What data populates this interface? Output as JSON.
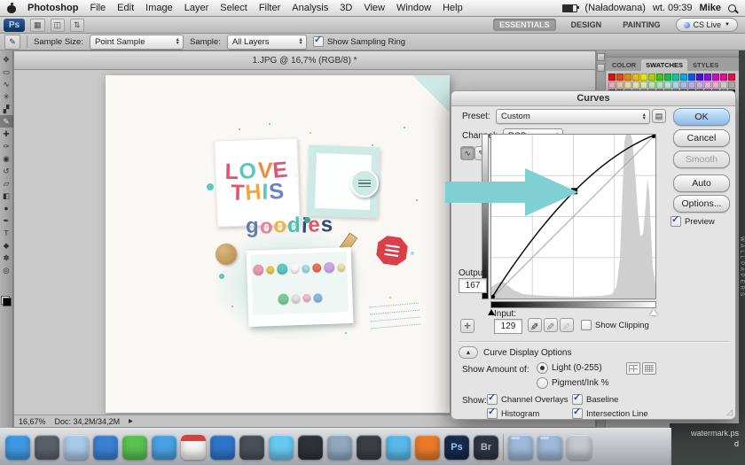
{
  "desktop": {
    "wallpaper_text": "WALLPAPERS",
    "watermark_line1": "watermark.ps",
    "watermark_line2": "d"
  },
  "menu_bar": {
    "app": "Photoshop",
    "items": [
      "File",
      "Edit",
      "Image",
      "Layer",
      "Select",
      "Filter",
      "Analysis",
      "3D",
      "View",
      "Window",
      "Help"
    ],
    "battery_text": "(Naładowana)",
    "clock": "wt. 09:39",
    "user": "Mike"
  },
  "app_bar": {
    "logo": "Ps",
    "workspaces": [
      {
        "label": "ESSENTIALS",
        "active": true
      },
      {
        "label": "DESIGN",
        "active": false
      },
      {
        "label": "PAINTING",
        "active": false
      }
    ],
    "cs_live": "CS Live"
  },
  "options_bar": {
    "sample_size_label": "Sample Size:",
    "sample_size_value": "Point Sample",
    "sample_label": "Sample:",
    "sample_value": "All Layers",
    "sampling_ring_label": "Show Sampling Ring",
    "sampling_ring_checked": true
  },
  "tools": [
    {
      "name": "move",
      "glyph": "✥"
    },
    {
      "name": "marquee",
      "glyph": "▭"
    },
    {
      "name": "lasso",
      "glyph": "∿"
    },
    {
      "name": "quick-selection",
      "glyph": "✳"
    },
    {
      "name": "crop",
      "glyph": "▞"
    },
    {
      "name": "eyedropper",
      "glyph": "✎",
      "selected": true
    },
    {
      "name": "healing-brush",
      "glyph": "✚"
    },
    {
      "name": "brush",
      "glyph": "✑"
    },
    {
      "name": "clone-stamp",
      "glyph": "◉"
    },
    {
      "name": "history-brush",
      "glyph": "↺"
    },
    {
      "name": "eraser",
      "glyph": "▱"
    },
    {
      "name": "gradient",
      "glyph": "◧"
    },
    {
      "name": "blur",
      "glyph": "●"
    },
    {
      "name": "pen",
      "glyph": "✒"
    },
    {
      "name": "type",
      "glyph": "T"
    },
    {
      "name": "shape",
      "glyph": "◆"
    },
    {
      "name": "hand",
      "glyph": "✽"
    },
    {
      "name": "zoom",
      "glyph": "◎"
    }
  ],
  "document": {
    "title": "1.JPG @ 16,7% (RGB/8) *",
    "status_zoom": "16,67%",
    "status_doc": "Doc: 34,2M/34,2M"
  },
  "artwork": {
    "love_letters": [
      {
        "ch": "L",
        "color": "#e0566e"
      },
      {
        "ch": "O",
        "color": "#5cc6bf"
      },
      {
        "ch": "V",
        "color": "#ee8a3c"
      },
      {
        "ch": "E",
        "color": "#e0566e"
      }
    ],
    "this_letters": [
      {
        "ch": "T",
        "color": "#e0566e"
      },
      {
        "ch": "H",
        "color": "#f0a83c"
      },
      {
        "ch": "I",
        "color": "#5cc6bf"
      },
      {
        "ch": "S",
        "color": "#6b82c4"
      }
    ],
    "goodies_letters": [
      {
        "ch": "g",
        "color": "#5b7fb5"
      },
      {
        "ch": "o",
        "color": "#e87ea1"
      },
      {
        "ch": "o",
        "color": "#f0b43c"
      },
      {
        "ch": "d",
        "color": "#52bdb6"
      },
      {
        "ch": "i",
        "color": "#2e4a7a"
      },
      {
        "ch": "e",
        "color": "#d8566a"
      },
      {
        "ch": "s",
        "color": "#2e4a7a"
      }
    ],
    "button_colors": [
      "#e89ab0",
      "#f0c452",
      "#5cc6bf",
      "#f8f8f8",
      "#a8d8e8",
      "#e8705a",
      "#c8a8e0",
      "#f0e0a0",
      "#7ac8a0",
      "#e0e0e0",
      "#f2b8c8",
      "#88b8e0"
    ]
  },
  "panels": {
    "tabs": [
      {
        "label": "COLOR",
        "active": false
      },
      {
        "label": "SWATCHES",
        "active": true
      },
      {
        "label": "STYLES",
        "active": false
      }
    ],
    "swatches": [
      "#e81010",
      "#e84b10",
      "#e88a10",
      "#e8c010",
      "#e8e810",
      "#a8d810",
      "#48c810",
      "#10c848",
      "#10c8a8",
      "#10a8e8",
      "#1058e8",
      "#4810e8",
      "#8a10e8",
      "#c810c8",
      "#e8108a",
      "#e81048",
      "#f5b8b8",
      "#f5cdb8",
      "#f5e2b8",
      "#f5f0b8",
      "#e8f5b8",
      "#c8f5b8",
      "#b8f5c8",
      "#b8f5e8",
      "#b8e2f5",
      "#b8c8f5",
      "#c4b8f5",
      "#dcb8f5",
      "#f5b8ec",
      "#f5b8d2",
      "#d8d8d8",
      "#b0b0b0",
      "#8a0b0b",
      "#8a3c0b",
      "#8a5c0b",
      "#8a7c0b",
      "#6c8a0b",
      "#3c8a0b",
      "#0b8a2c",
      "#0b8a6c",
      "#0b6c8a",
      "#0b3c8a",
      "#1c0b8a",
      "#4c0b8a",
      "#7c0b8a",
      "#8a0b5c",
      "#5a5a5a",
      "#2a2a2a"
    ]
  },
  "curves": {
    "title": "Curves",
    "preset_label": "Preset:",
    "preset_value": "Custom",
    "channel_label": "Channel:",
    "channel_value": "RGB",
    "ok": "OK",
    "cancel": "Cancel",
    "smooth": "Smooth",
    "auto": "Auto",
    "options": "Options...",
    "preview_label": "Preview",
    "preview_checked": true,
    "output_label": "Output:",
    "output_value": "167",
    "input_label": "Input:",
    "input_value": "129",
    "show_clipping_label": "Show Clipping",
    "show_clipping_checked": false,
    "display_options_label": "Curve Display Options",
    "show_amount_label": "Show Amount of:",
    "amount_options": [
      {
        "label": "Light (0-255)",
        "selected": true
      },
      {
        "label": "Pigment/Ink %",
        "selected": false
      }
    ],
    "show_label": "Show:",
    "show_checkboxes": [
      {
        "label": "Channel Overlays",
        "checked": true
      },
      {
        "label": "Baseline",
        "checked": true
      },
      {
        "label": "Histogram",
        "checked": true
      },
      {
        "label": "Intersection Line",
        "checked": true
      }
    ],
    "curve_point": {
      "input": 129,
      "output": 167
    },
    "accent_arrow_color": "#7ed0d3"
  },
  "dock": {
    "apps": [
      {
        "name": "finder",
        "color": "#3f97e0"
      },
      {
        "name": "dashboard",
        "color": "#5a6069"
      },
      {
        "name": "mail",
        "color": "#a9c9e9"
      },
      {
        "name": "safari",
        "color": "#3b7fd0"
      },
      {
        "name": "ichat",
        "color": "#58c050"
      },
      {
        "name": "itunes",
        "color": "#4aa0e0"
      },
      {
        "name": "ical",
        "color": "#f4f4f0",
        "cal": true
      },
      {
        "name": "app-store",
        "color": "#2f74c8"
      },
      {
        "name": "photo-booth",
        "color": "#4a4f58"
      },
      {
        "name": "twitter",
        "color": "#68c8f0"
      },
      {
        "name": "terminal",
        "color": "#2e3238"
      },
      {
        "name": "preview",
        "color": "#8fa8bf"
      },
      {
        "name": "dvd-player",
        "color": "#3a3f46"
      },
      {
        "name": "skype",
        "color": "#58b8e8"
      },
      {
        "name": "vlc",
        "color": "#e87a2a"
      },
      {
        "name": "photoshop",
        "color": "#16294e",
        "label": "Ps",
        "label_color": "#9cc6f0"
      },
      {
        "name": "bridge",
        "color": "#2e3442",
        "label": "Br",
        "label_color": "#a8b4c8"
      }
    ],
    "extras": [
      {
        "name": "folder-applications",
        "color": "#9db8d8",
        "folder": true
      },
      {
        "name": "folder-documents",
        "color": "#9db8d8",
        "folder": true
      },
      {
        "name": "trash",
        "color": "#c4c8ce"
      }
    ]
  }
}
